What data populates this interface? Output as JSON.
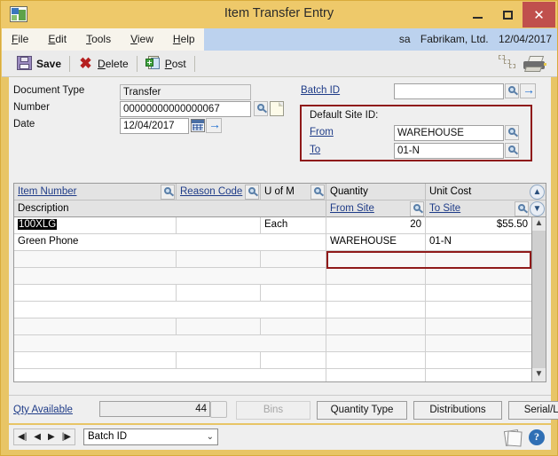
{
  "window": {
    "title": "Item Transfer Entry",
    "icon": "app-icon",
    "minimize": "–",
    "maximize": "□",
    "close": "✕"
  },
  "menu": {
    "items": [
      {
        "label": "File",
        "accel": "F"
      },
      {
        "label": "Edit",
        "accel": "E"
      },
      {
        "label": "Tools",
        "accel": "T"
      },
      {
        "label": "View",
        "accel": "V"
      },
      {
        "label": "Help",
        "accel": "H"
      }
    ],
    "status": {
      "user": "sa",
      "company": "Fabrikam, Ltd.",
      "date": "12/04/2017"
    }
  },
  "toolbar": {
    "save_label": "Save",
    "delete_label": "Delete",
    "post_label": "Post",
    "print_icon": "printer-icon",
    "copy_icon": "copy-icon"
  },
  "header_form": {
    "document_type_label": "Document Type",
    "document_type_value": "Transfer",
    "number_label": "Number",
    "number_value": "00000000000000067",
    "date_label": "Date",
    "date_value": "12/04/2017",
    "batch_id_label": "Batch ID",
    "batch_id_value": ""
  },
  "default_site": {
    "group_label": "Default Site ID:",
    "from_label": "From",
    "from_value": "WAREHOUSE",
    "to_label": "To",
    "to_value": "01-N"
  },
  "grid": {
    "headers_row1": [
      {
        "label": "Item Number",
        "link": true,
        "lookup": true
      },
      {
        "label": "Reason Code",
        "link": true,
        "lookup": true
      },
      {
        "label": "U of M",
        "link": false,
        "lookup": true
      },
      {
        "label": "Quantity",
        "link": false,
        "lookup": false
      },
      {
        "label": "Unit Cost",
        "link": false,
        "lookup": false
      }
    ],
    "headers_row2": [
      {
        "label": "Description",
        "link": false,
        "lookup": false
      },
      {
        "label": "From Site",
        "link": true,
        "lookup": true
      },
      {
        "label": "To Site",
        "link": true,
        "lookup": true
      }
    ],
    "expand_icon": "chevron-up-circle-icon",
    "collapse_icon": "chevron-down-circle-icon",
    "rows": [
      {
        "item_number": "100XLG",
        "item_number_selected": true,
        "reason_code": "",
        "uom": "Each",
        "quantity": "20",
        "unit_cost": "$55.50",
        "description": "Green Phone",
        "from_site": "WAREHOUSE",
        "to_site": "01-N",
        "highlight_sites": true
      }
    ],
    "empty_row_count": 8
  },
  "footer": {
    "qty_available_label": "Qty Available",
    "qty_available_value": "44",
    "buttons": [
      {
        "label": "Bins",
        "accel": "n",
        "disabled": true
      },
      {
        "label": "Quantity Type",
        "accel": "Q",
        "disabled": false
      },
      {
        "label": "Distributions",
        "accel": "b",
        "disabled": false
      },
      {
        "label": "Serial/Lot",
        "accel": "/",
        "disabled": false
      }
    ]
  },
  "navbar": {
    "first": "◀|",
    "prev": "◀",
    "next": "▶",
    "last": "|▶",
    "combo_value": "Batch ID",
    "combo_caret": "⌄",
    "notes_icon": "notes-icon",
    "help_icon": "help-icon",
    "help_label": "?"
  },
  "colors": {
    "title_bar": "#eec96a",
    "close_button": "#c0504d",
    "menu_status_bg": "#bcd2ee",
    "highlight_border": "#8f1a1a",
    "link": "#1f3c88"
  }
}
